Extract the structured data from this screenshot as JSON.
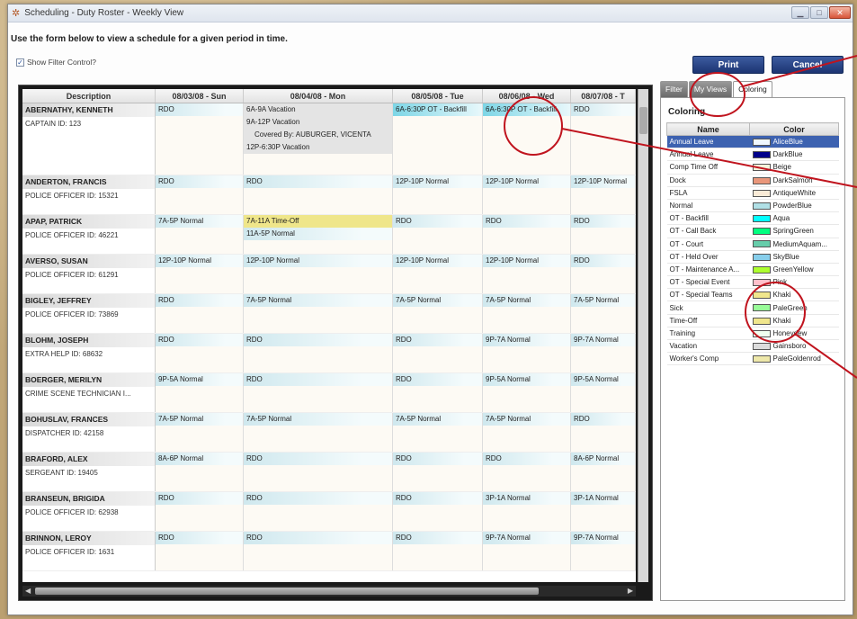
{
  "window": {
    "title": "Scheduling - Duty Roster - Weekly View",
    "buttons": [
      "minimize",
      "maximize",
      "close"
    ]
  },
  "form": {
    "instruction": "Use the form below to view a schedule for a given period in time.",
    "show_filter_label": "Show Filter Control?",
    "show_filter_checked": true,
    "print_label": "Print",
    "cancel_label": "Cancel"
  },
  "roster": {
    "columns": [
      "Description",
      "08/03/08 - Sun",
      "08/04/08 - Mon",
      "08/05/08 - Tue",
      "08/06/08 - Wed",
      "08/07/08 - T"
    ],
    "employees": [
      {
        "name": "ABERNATHY, KENNETH",
        "title": "CAPTAIN   ID: 123",
        "days": [
          [
            "RDO"
          ],
          [
            "6A-9A  Vacation",
            "9A-12P  Vacation",
            "Covered By: AUBURGER, VICENTA",
            "12P-6:30P  Vacation"
          ],
          [
            "6A-6:30P  OT - Backfill"
          ],
          [
            "6A-6:30P  OT - Backfill"
          ],
          [
            "RDO"
          ]
        ]
      },
      {
        "name": "ANDERTON, FRANCIS",
        "title": "POLICE OFFICER   ID: 15321",
        "days": [
          [
            "RDO"
          ],
          [
            "RDO"
          ],
          [
            "12P-10P  Normal"
          ],
          [
            "12P-10P  Normal"
          ],
          [
            "12P-10P  Normal"
          ]
        ]
      },
      {
        "name": "APAP, PATRICK",
        "title": "POLICE OFFICER   ID: 46221",
        "days": [
          [
            "7A-5P  Normal"
          ],
          [
            "7A-11A  Time-Off",
            "11A-5P  Normal"
          ],
          [
            "RDO"
          ],
          [
            "RDO"
          ],
          [
            "RDO"
          ]
        ]
      },
      {
        "name": "AVERSO, SUSAN",
        "title": "POLICE OFFICER   ID: 61291",
        "days": [
          [
            "12P-10P  Normal"
          ],
          [
            "12P-10P  Normal"
          ],
          [
            "12P-10P  Normal"
          ],
          [
            "12P-10P  Normal"
          ],
          [
            "RDO"
          ]
        ]
      },
      {
        "name": "BIGLEY, JEFFREY",
        "title": "POLICE OFFICER   ID: 73869",
        "days": [
          [
            "RDO"
          ],
          [
            "7A-5P  Normal"
          ],
          [
            "7A-5P  Normal"
          ],
          [
            "7A-5P  Normal"
          ],
          [
            "7A-5P  Normal"
          ]
        ]
      },
      {
        "name": "BLOHM, JOSEPH",
        "title": "EXTRA HELP   ID: 68632",
        "days": [
          [
            "RDO"
          ],
          [
            "RDO"
          ],
          [
            "RDO"
          ],
          [
            "9P-7A  Normal"
          ],
          [
            "9P-7A  Normal"
          ]
        ]
      },
      {
        "name": "BOERGER, MERILYN",
        "title": "CRIME SCENE TECHNICIAN   I...",
        "days": [
          [
            "9P-5A  Normal"
          ],
          [
            "RDO"
          ],
          [
            "RDO"
          ],
          [
            "9P-5A  Normal"
          ],
          [
            "9P-5A  Normal"
          ]
        ]
      },
      {
        "name": "BOHUSLAV, FRANCES",
        "title": "DISPATCHER   ID: 42158",
        "days": [
          [
            "7A-5P  Normal"
          ],
          [
            "7A-5P  Normal"
          ],
          [
            "7A-5P  Normal"
          ],
          [
            "7A-5P  Normal"
          ],
          [
            "RDO"
          ]
        ]
      },
      {
        "name": "BRAFORD, ALEX",
        "title": "SERGEANT   ID: 19405",
        "days": [
          [
            "8A-6P  Normal"
          ],
          [
            "RDO"
          ],
          [
            "RDO"
          ],
          [
            "RDO"
          ],
          [
            "8A-6P  Normal"
          ]
        ]
      },
      {
        "name": "BRANSEUN, BRIGIDA",
        "title": "POLICE OFFICER   ID: 62938",
        "days": [
          [
            "RDO"
          ],
          [
            "RDO"
          ],
          [
            "RDO"
          ],
          [
            "3P-1A  Normal"
          ],
          [
            "3P-1A  Normal"
          ]
        ]
      },
      {
        "name": "BRINNON, LEROY",
        "title": "POLICE OFFICER   ID: 1631",
        "days": [
          [
            "RDO"
          ],
          [
            "RDO"
          ],
          [
            "RDO"
          ],
          [
            "9P-7A  Normal"
          ],
          [
            "9P-7A  Normal"
          ]
        ]
      }
    ]
  },
  "panel": {
    "tabs": [
      "Filter",
      "My Views",
      "Coloring"
    ],
    "active_tab": "Coloring",
    "heading": "Coloring",
    "col_name": "Name",
    "col_color": "Color",
    "rows": [
      {
        "name": "Annual Leave",
        "color": "AliceBlue",
        "hex": "#f0f8ff",
        "selected": true
      },
      {
        "name": "Annual Leave",
        "color": "DarkBlue",
        "hex": "#00008b"
      },
      {
        "name": "Comp Time Off",
        "color": "Beige",
        "hex": "#f5f5dc"
      },
      {
        "name": "Dock",
        "color": "DarkSalmon",
        "hex": "#e9967a"
      },
      {
        "name": "FSLA",
        "color": "AntiqueWhite",
        "hex": "#faebd7"
      },
      {
        "name": "Normal",
        "color": "PowderBlue",
        "hex": "#b0e0e6"
      },
      {
        "name": "OT - Backfill",
        "color": "Aqua",
        "hex": "#00ffff"
      },
      {
        "name": "OT - Call Back",
        "color": "SpringGreen",
        "hex": "#00ff7f"
      },
      {
        "name": "OT - Court",
        "color": "MediumAquam...",
        "hex": "#66cdaa"
      },
      {
        "name": "OT - Held Over",
        "color": "SkyBlue",
        "hex": "#87ceeb"
      },
      {
        "name": "OT - Maintenance A...",
        "color": "GreenYellow",
        "hex": "#adff2f"
      },
      {
        "name": "OT - Special Event",
        "color": "Pink",
        "hex": "#ffc0cb"
      },
      {
        "name": "OT - Special Teams",
        "color": "Khaki",
        "hex": "#f0e68c"
      },
      {
        "name": "Sick",
        "color": "PaleGreen",
        "hex": "#98fb98"
      },
      {
        "name": "Time-Off",
        "color": "Khaki",
        "hex": "#f0e68c"
      },
      {
        "name": "Training",
        "color": "Honeydew",
        "hex": "#f0fff0"
      },
      {
        "name": "Vacation",
        "color": "Gainsboro",
        "hex": "#dcdcdc"
      },
      {
        "name": "Worker's Comp",
        "color": "PaleGoldenrod",
        "hex": "#eee8aa"
      }
    ]
  },
  "colors": {
    "button_blue": "#1c3472",
    "annotation_red": "#c0141e",
    "selection_blue": "#3d62b0"
  }
}
